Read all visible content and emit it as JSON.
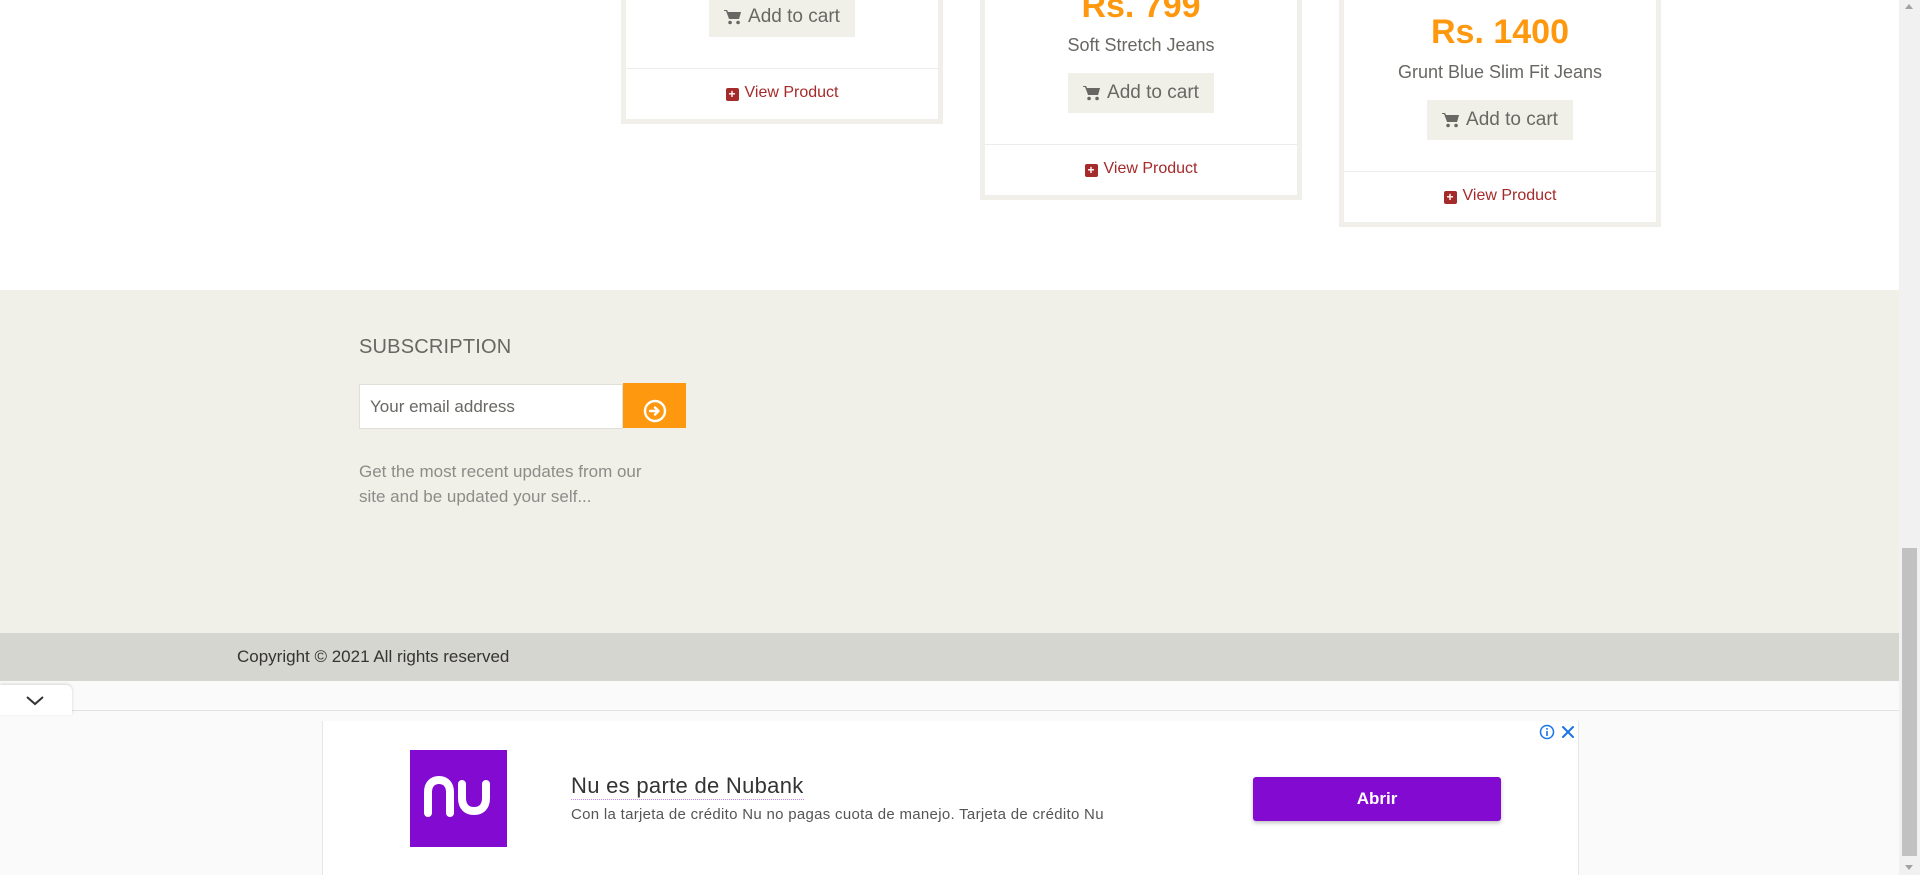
{
  "products": [
    {
      "name": "",
      "price": "",
      "cart_label": "Add to cart",
      "view_label": "View Product"
    },
    {
      "name": "Soft Stretch Jeans",
      "price": "Rs. 799",
      "cart_label": "Add to cart",
      "view_label": "View Product"
    },
    {
      "name": "Grunt Blue Slim Fit Jeans",
      "price": "Rs. 1400",
      "cart_label": "Add to cart",
      "view_label": "View Product"
    }
  ],
  "footer": {
    "subscription_title": "SUBSCRIPTION",
    "email_placeholder": "Your email address",
    "description": "Get the most recent updates from our site and be updated your self...",
    "copyright": "Copyright © 2021 All rights reserved"
  },
  "ad": {
    "title": "Nu es parte de Nubank",
    "description": "Con la tarjeta de crédito Nu no pagas cuota de manejo. Tarjeta de crédito Nu",
    "cta_label": "Abrir",
    "brand_logo_text": "nu",
    "brand_color": "#820ad1"
  },
  "colors": {
    "price": "#fe980f",
    "view_link": "#a52a2a",
    "subscribe_button": "#fe980f",
    "footer_background": "#f0efe8",
    "copyright_background": "#d6d6d0"
  }
}
